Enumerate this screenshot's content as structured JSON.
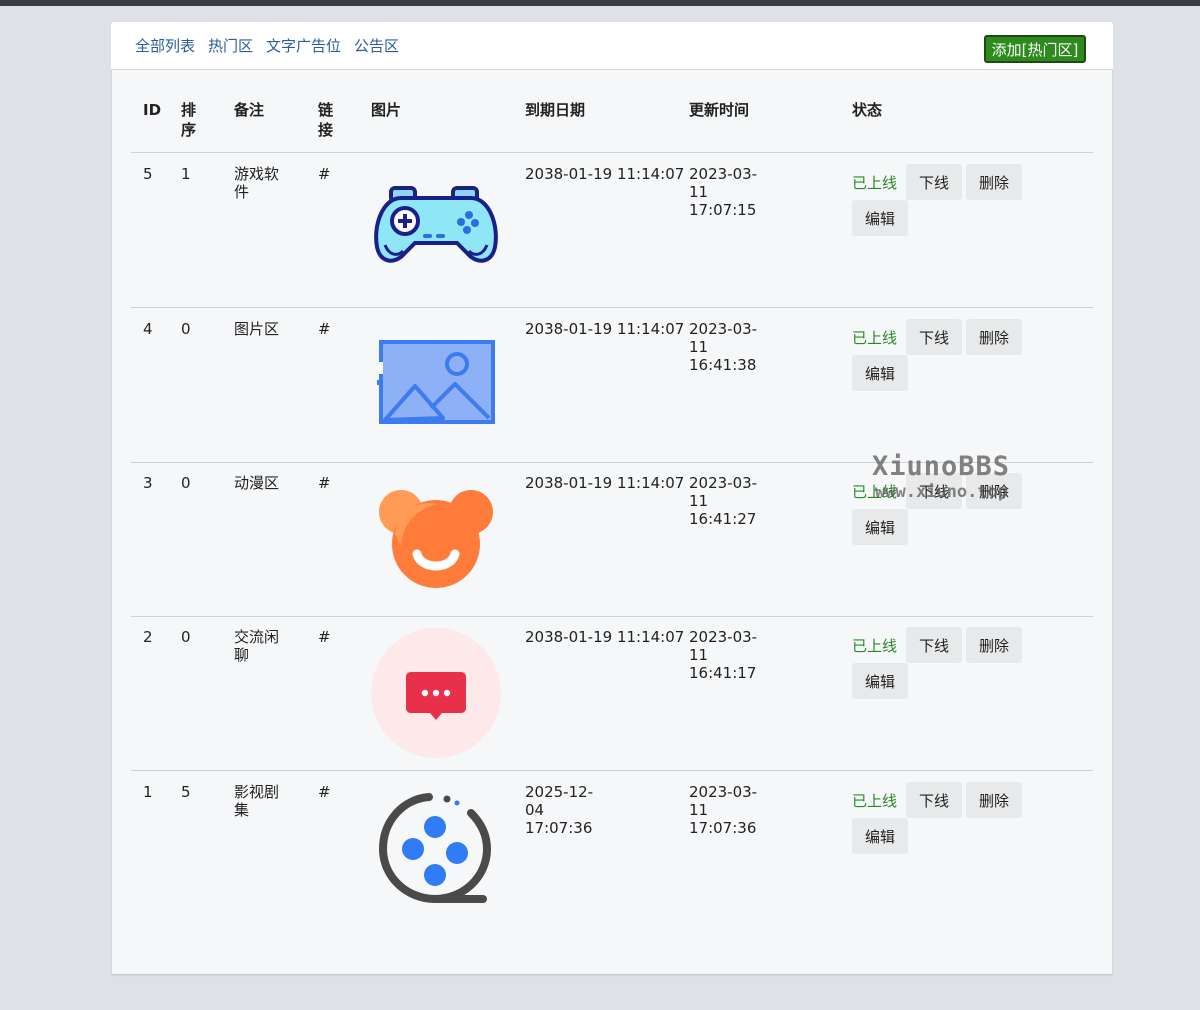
{
  "nav": {
    "tabs": [
      "全部列表",
      "热门区",
      "文字广告位",
      "公告区"
    ],
    "add_button": "添加[热门区]"
  },
  "table": {
    "headers": {
      "id": "ID",
      "sort": "排序",
      "note": "备注",
      "link": "链接",
      "image": "图片",
      "expire": "到期日期",
      "updated": "更新时间",
      "status": "状态"
    },
    "rows": [
      {
        "id": "5",
        "sort": "1",
        "note": "游戏软件",
        "link": "#",
        "image": "gamepad-icon",
        "expire": "2038-01-19 11:14:07",
        "updated": "2023-03-11 17:07:15",
        "status": "已上线",
        "btn_off": "下线",
        "btn_delete": "删除",
        "btn_edit": "编辑"
      },
      {
        "id": "4",
        "sort": "0",
        "note": "图片区",
        "link": "#",
        "image": "picture-icon",
        "expire": "2038-01-19 11:14:07",
        "updated": "2023-03-11 16:41:38",
        "status": "已上线",
        "btn_off": "下线",
        "btn_delete": "删除",
        "btn_edit": "编辑"
      },
      {
        "id": "3",
        "sort": "0",
        "note": "动漫区",
        "link": "#",
        "image": "bear-icon",
        "expire": "2038-01-19 11:14:07",
        "updated": "2023-03-11 16:41:27",
        "status": "已上线",
        "btn_off": "下线",
        "btn_delete": "删除",
        "btn_edit": "编辑"
      },
      {
        "id": "2",
        "sort": "0",
        "note": "交流闲聊",
        "link": "#",
        "image": "chat-bubble-icon",
        "expire": "2038-01-19 11:14:07",
        "updated": "2023-03-11 16:41:17",
        "status": "已上线",
        "btn_off": "下线",
        "btn_delete": "删除",
        "btn_edit": "编辑"
      },
      {
        "id": "1",
        "sort": "5",
        "note": "影视剧集",
        "link": "#",
        "image": "film-reel-icon",
        "expire": "2025-12-04 17:07:36",
        "updated": "2023-03-11 17:07:36",
        "status": "已上线",
        "btn_off": "下线",
        "btn_delete": "删除",
        "btn_edit": "编辑"
      }
    ]
  },
  "watermark": {
    "line1": "XiunoBBS",
    "line2": "www.xiuno.top"
  },
  "colors": {
    "accent_link": "#2b5c9e",
    "add_button": "#2d8a1d",
    "status_online": "#2a8a2a"
  }
}
